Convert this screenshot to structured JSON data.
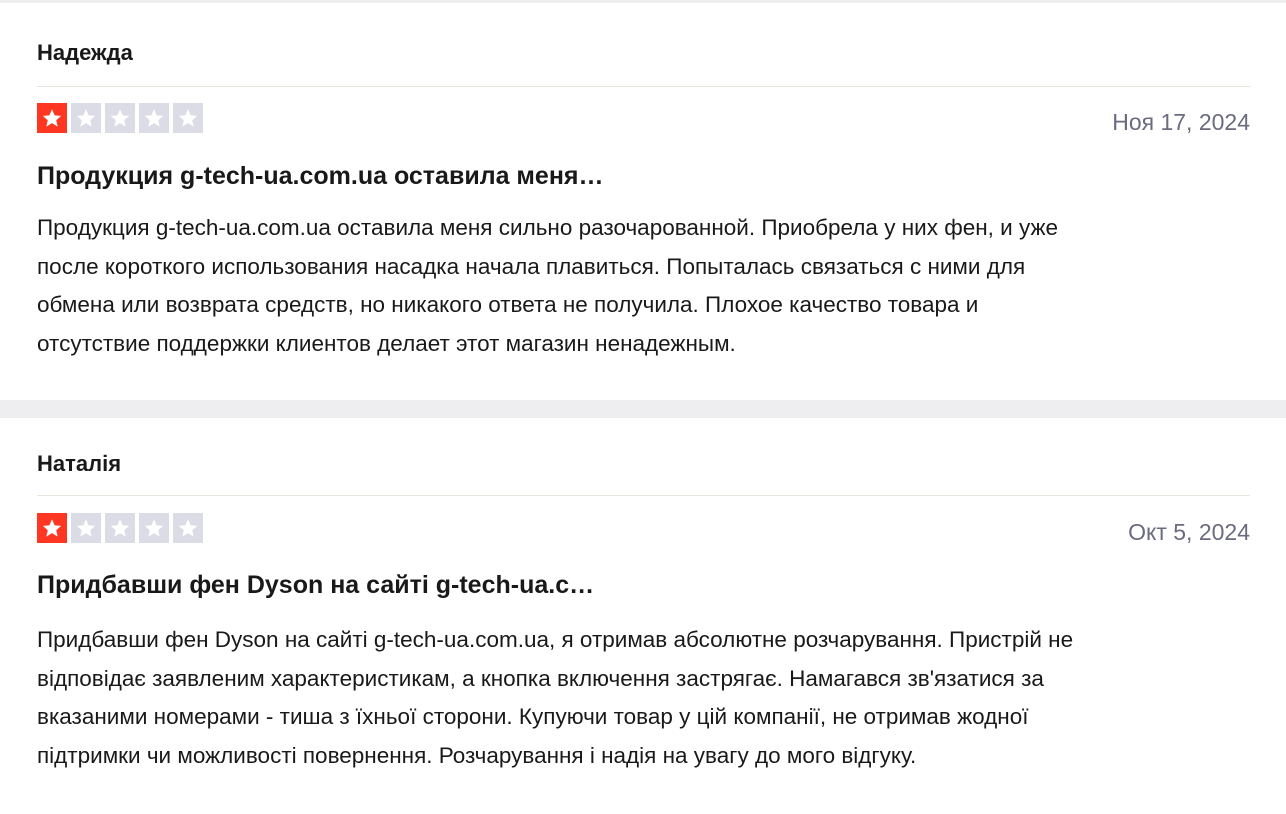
{
  "reviews": [
    {
      "author": "Надежда",
      "rating": 1,
      "rating_max": 5,
      "date": "Ноя 17, 2024",
      "title": "Продукция g-tech-ua.com.ua оставила меня…",
      "body_lines": [
        "Продукция g-tech-ua.com.ua оставила меня сильно разочарованной. Приобрела у них фен, и уже",
        "после короткого использования насадка начала плавиться. Попыталась связаться с ними для",
        "обмена или возврата средств, но никакого ответа не получила. Плохое качество товара и",
        "отсутствие поддержки клиентов делает этот магазин ненадежным."
      ]
    },
    {
      "author": "Наталія",
      "rating": 1,
      "rating_max": 5,
      "date": "Окт 5, 2024",
      "title": "Придбавши фен Dyson на сайті g-tech-ua.c…",
      "body_lines": [
        "Придбавши фен Dyson на сайті g-tech-ua.com.ua, я отримав абсолютне розчарування. Пристрій не",
        "відповідає заявленим характеристикам, а кнопка включення застрягає. Намагався зв'язатися за",
        "вказаними номерами - тиша з їхньої сторони. Купуючи товар у цій компанії, не отримав жодної",
        "підтримки чи можливості повернення. Розчарування і надія на увагу до мого відгуку."
      ]
    }
  ],
  "colors": {
    "star_filled": "#ff3722",
    "star_empty": "#dcdce6",
    "separator": "#eeeef1",
    "date_text": "#6b6b80"
  },
  "icons": {
    "star": "star-icon"
  }
}
